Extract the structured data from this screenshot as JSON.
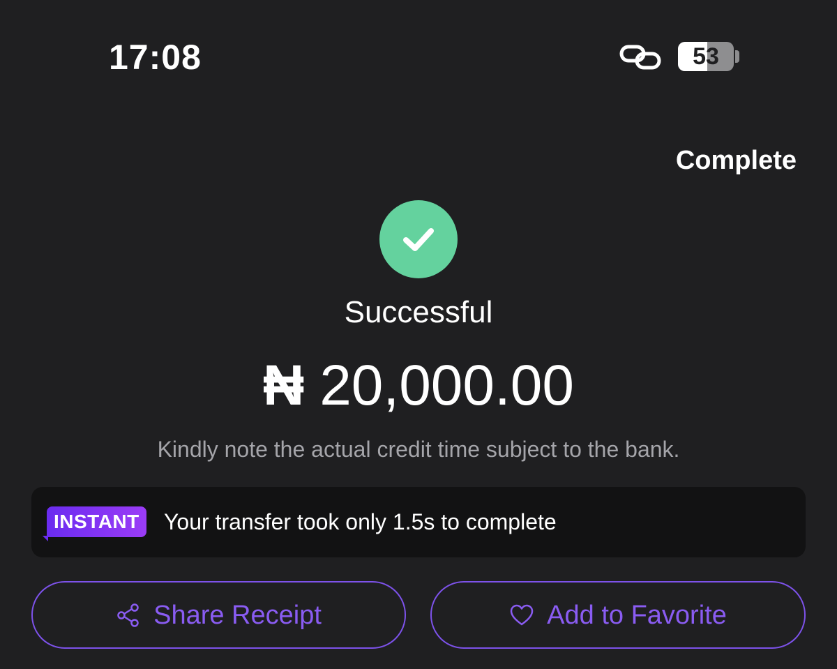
{
  "status_bar": {
    "time": "17:08",
    "battery_level": "53",
    "battery_fraction": 0.53
  },
  "header": {
    "complete_label": "Complete"
  },
  "result": {
    "status": "Successful",
    "currency_symbol": "₦",
    "amount": "20,000.00",
    "note": "Kindly note the actual credit time subject to the bank."
  },
  "instant_banner": {
    "badge": "INSTANT",
    "message": "Your transfer took only 1.5s to complete"
  },
  "actions": {
    "share_label": "Share Receipt",
    "favorite_label": "Add to Favorite"
  },
  "icons": {
    "status_link": "link-icon",
    "success": "checkmark-icon",
    "share": "share-icon",
    "favorite": "heart-icon"
  },
  "colors": {
    "background": "#1f1f21",
    "success_green": "#64d29e",
    "accent_purple": "#7d52ea",
    "banner_bg": "#121213",
    "muted_text": "#a5a5aa"
  }
}
